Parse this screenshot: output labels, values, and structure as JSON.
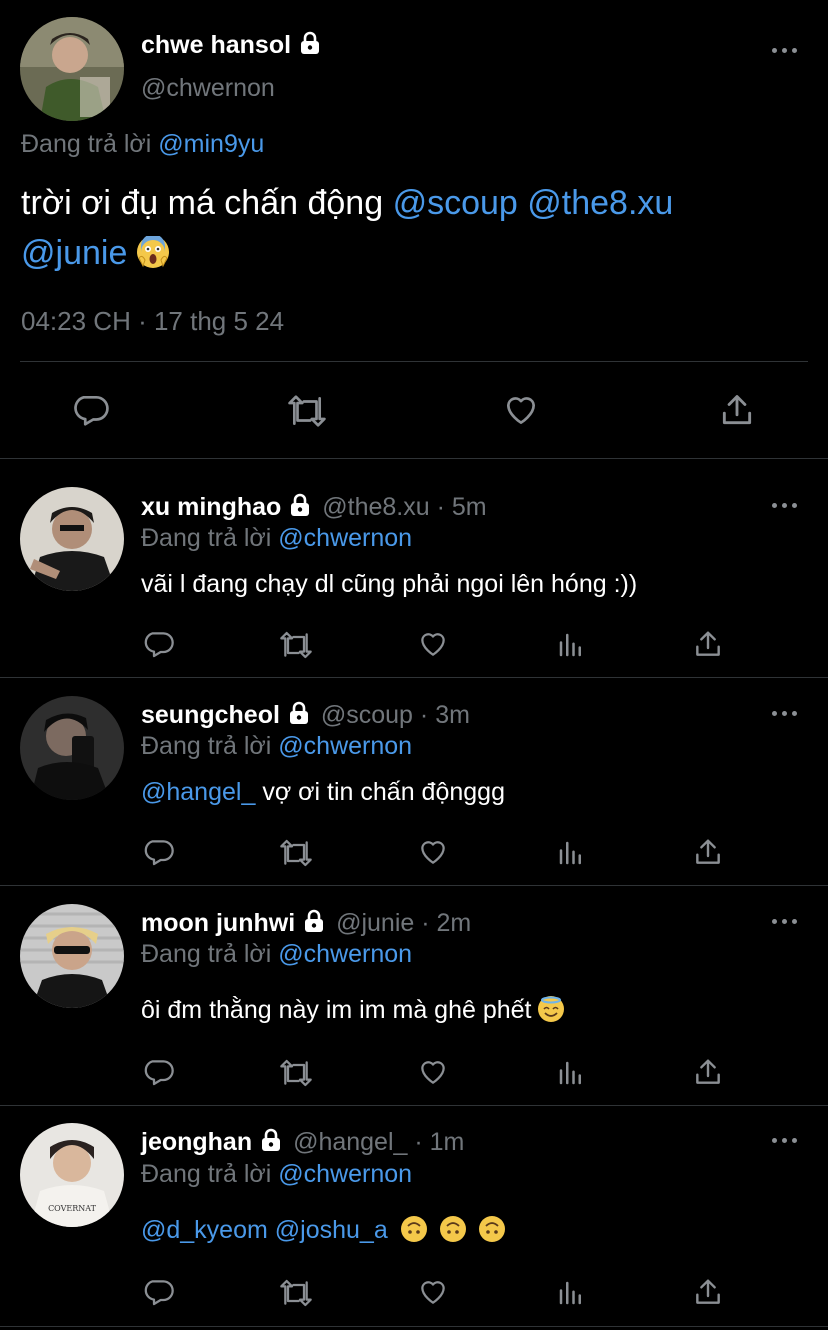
{
  "main_tweet": {
    "name": "chwe hansol",
    "handle": "@chwernon",
    "reply_prefix": "Đang trả lời",
    "reply_to": "@min9yu",
    "text_plain": "trời ơi đụ má chấn động",
    "mention_1": "@scoup",
    "mention_2": "@the8.xu",
    "mention_3": "@junie",
    "emoji": "screaming-face",
    "timestamp": "04:23 CH · 17 thg 5 24"
  },
  "replies": [
    {
      "name": "xu minghao",
      "handle": "@the8.xu",
      "time": "· 5m",
      "reply_prefix": "Đang trả lời",
      "reply_to": "@chwernon",
      "text": "vãi l đang chạy dl cũng phải ngoi lên hóng :))"
    },
    {
      "name": "seungcheol",
      "handle": "@scoup",
      "time": "· 3m",
      "reply_prefix": "Đang trả lời",
      "reply_to": "@chwernon",
      "mention": "@hangel_",
      "text": "vợ ơi tin chấn độnggg"
    },
    {
      "name": "moon junhwi",
      "handle": "@junie",
      "time": "· 2m",
      "reply_prefix": "Đang trả lời",
      "reply_to": "@chwernon",
      "text": "ôi đm thằng này im im mà ghê phết",
      "emoji": "smiling-face-with-halo"
    },
    {
      "name": "jeonghan",
      "handle": "@hangel_",
      "time": "· 1m",
      "reply_prefix": "Đang trả lời",
      "reply_to": "@chwernon",
      "mentions": "@d_kyeom @joshu_a",
      "emoji": "upside-down-face"
    }
  ],
  "colors": {
    "background": "#000000",
    "text": "#e7e9ea",
    "link": "#4a99e9",
    "muted": "#71767b",
    "divider": "#2f3336"
  }
}
